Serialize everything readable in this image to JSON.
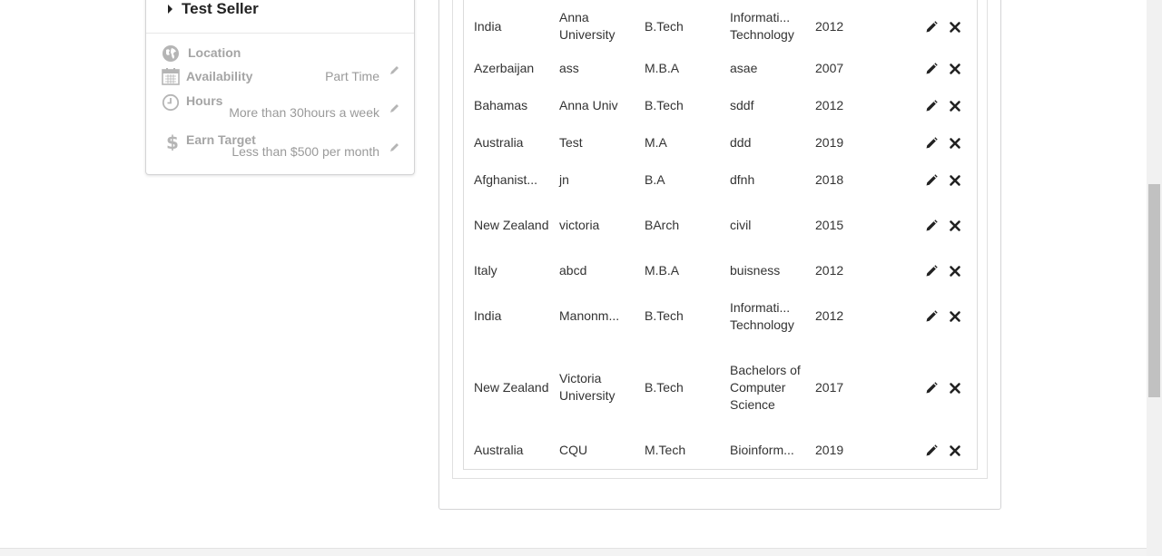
{
  "sidebar": {
    "seller_name": "Test Seller",
    "location_label": "Location",
    "availability_label": "Availability",
    "availability_value": "Part Time",
    "hours_label": "Hours",
    "hours_value": "More than 30hours a week",
    "earn_label": "Earn Target",
    "earn_value": "Less than $500 per month"
  },
  "education": {
    "rows": [
      {
        "country": "India",
        "university": "Anna University",
        "degree": "B.Tech",
        "field": "Informati... Technology",
        "year": "2012"
      },
      {
        "country": "Azerbaijan",
        "university": "ass",
        "degree": "M.B.A",
        "field": "asae",
        "year": "2007"
      },
      {
        "country": "Bahamas",
        "university": "Anna Univ",
        "degree": "B.Tech",
        "field": "sddf",
        "year": "2012"
      },
      {
        "country": "Australia",
        "university": "Test",
        "degree": "M.A",
        "field": "ddd",
        "year": "2019"
      },
      {
        "country": "Afghanist...",
        "university": "jn",
        "degree": "B.A",
        "field": "dfnh",
        "year": "2018"
      },
      {
        "country": "New Zealand",
        "university": "victoria",
        "degree": "BArch",
        "field": "civil",
        "year": "2015"
      },
      {
        "country": "Italy",
        "university": "abcd",
        "degree": "M.B.A",
        "field": "buisness",
        "year": "2012"
      },
      {
        "country": "India",
        "university": "Manonm...",
        "degree": "B.Tech",
        "field": "Informati... Technology",
        "year": "2012"
      },
      {
        "country": "New Zealand",
        "university": "Victoria University",
        "degree": "B.Tech",
        "field": "Bachelors of Computer Science",
        "year": "2017"
      },
      {
        "country": "Australia",
        "university": "CQU",
        "degree": "M.Tech",
        "field": "Bioinform...",
        "year": "2019"
      }
    ]
  },
  "icons": {
    "location": "globe-icon",
    "availability": "calendar-icon",
    "hours": "clock-icon",
    "earn": "dollar-icon",
    "edit": "pencil-icon",
    "delete": "close-icon"
  },
  "colors": {
    "label_gray": "#a5a5a5",
    "icon_gray": "#b5b5b5",
    "action_dark": "#222222"
  }
}
